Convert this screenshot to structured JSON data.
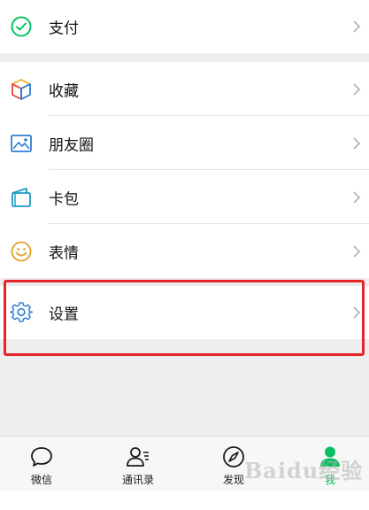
{
  "menu": {
    "pay": {
      "label": "支付",
      "icon": "pay-check-icon"
    },
    "items": [
      {
        "label": "收藏",
        "icon": "favorites-cube-icon"
      },
      {
        "label": "朋友圈",
        "icon": "moments-photo-icon"
      },
      {
        "label": "卡包",
        "icon": "card-wallet-icon"
      },
      {
        "label": "表情",
        "icon": "sticker-smile-icon"
      }
    ],
    "settings": {
      "label": "设置",
      "icon": "gear-icon"
    }
  },
  "tabs": [
    {
      "label": "微信",
      "icon": "chat-bubble-icon",
      "active": false
    },
    {
      "label": "通讯录",
      "icon": "contacts-icon",
      "active": false
    },
    {
      "label": "发现",
      "icon": "compass-icon",
      "active": false
    },
    {
      "label": "我",
      "icon": "person-icon",
      "active": true
    }
  ],
  "colors": {
    "accent": "#07c160",
    "highlight": "#e8242b",
    "background": "#ededed"
  },
  "watermark": "Baidu经验"
}
